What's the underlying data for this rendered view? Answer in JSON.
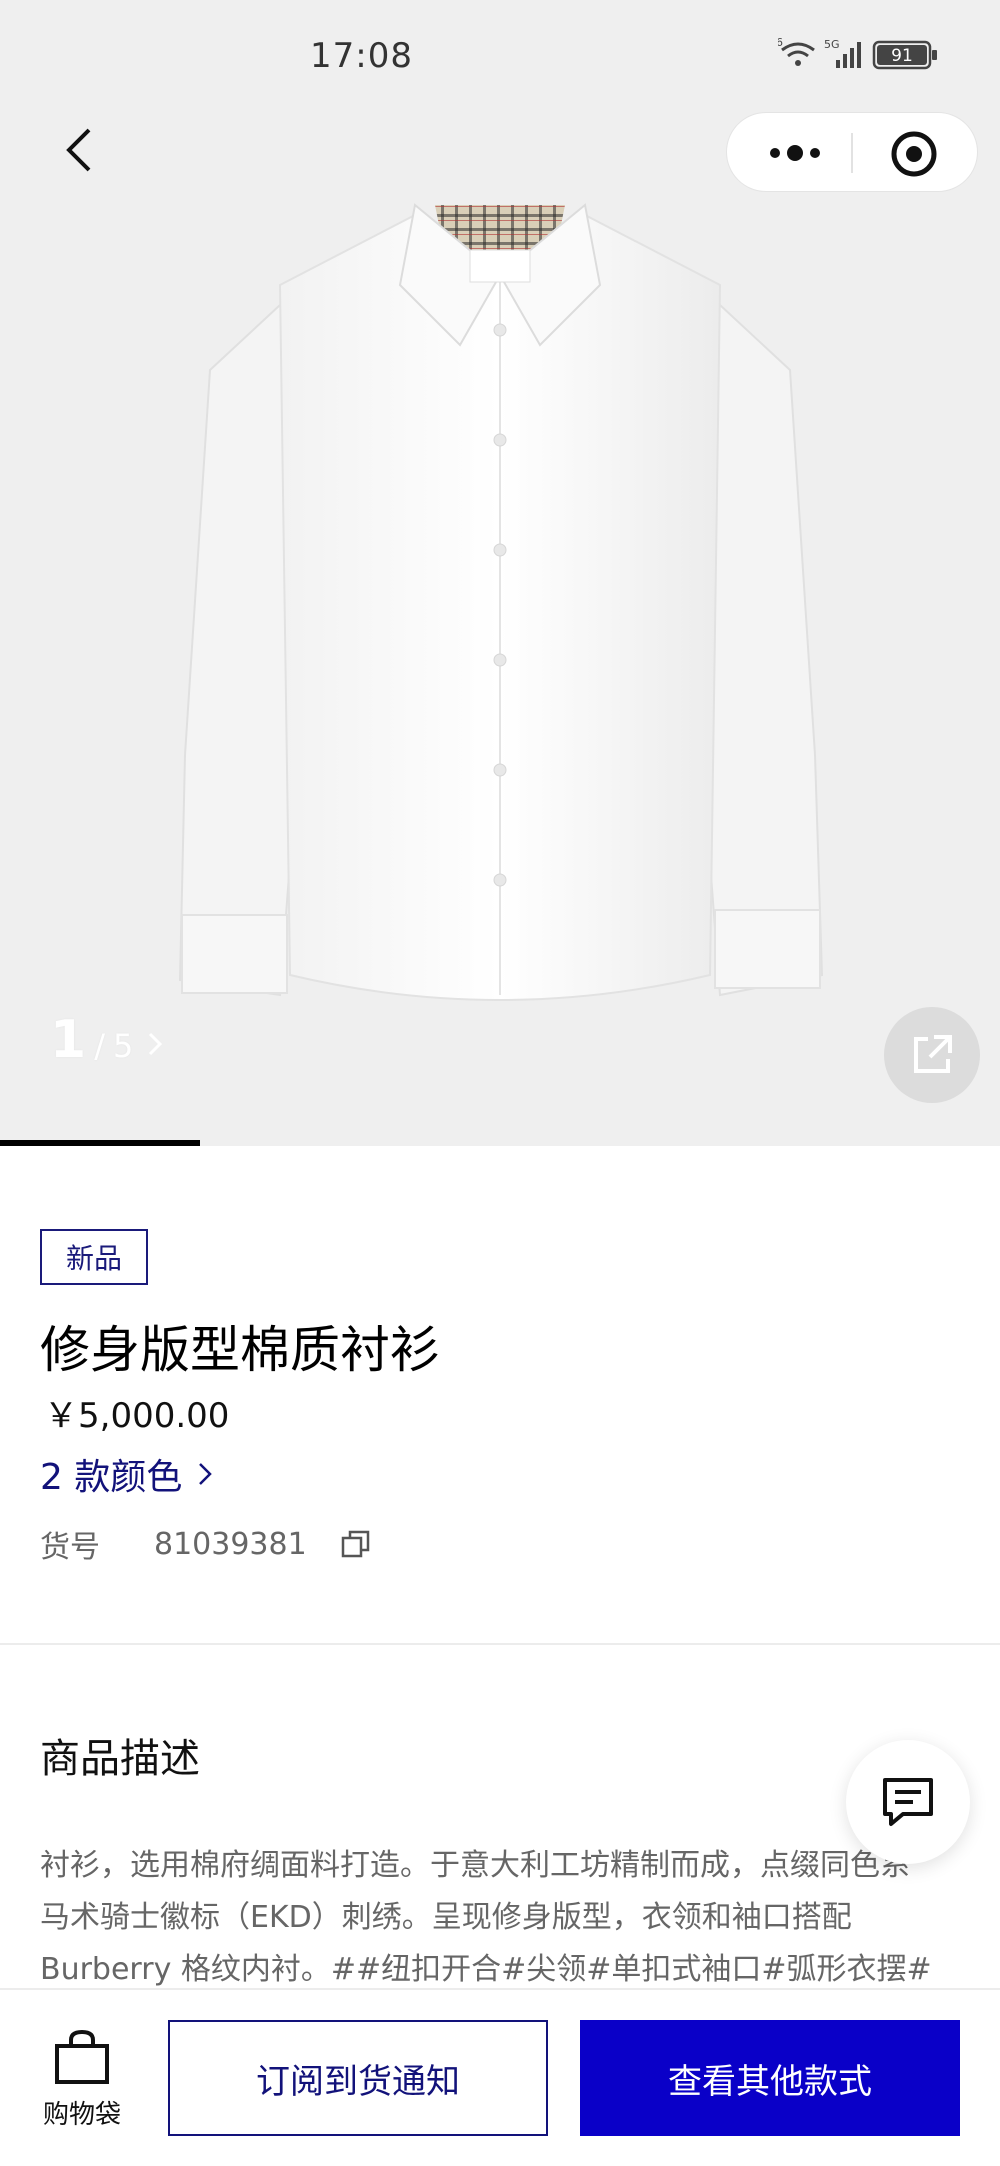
{
  "status_bar": {
    "time": "17:08",
    "network": "5G",
    "wifi_badge": "6",
    "battery": "91"
  },
  "nav": {
    "back_icon": "chevron-left-icon",
    "more_icon": "more-dots-icon",
    "target_icon": "target-icon"
  },
  "gallery": {
    "current": "1",
    "separator": "/",
    "total": "5",
    "progress": 0.2
  },
  "product": {
    "badge": "新品",
    "title": "修身版型棉质衬衫",
    "price": "￥5,000.00",
    "colors_link": "2 款颜色",
    "sku_label": "货号",
    "sku_number": "81039381"
  },
  "description": {
    "heading": "商品描述",
    "text": "衬衫，选用棉府绸面料打造。于意大利工坊精制而成，点缀同色系\n马术骑士徽标（EKD）刺绣。呈现修身版型，衣领和袖口搭配\nBurberry 格纹内衬。##纽扣开合#尖领#单扣式袖口#弧形衣摆#"
  },
  "bottom_bar": {
    "bag_label": "购物袋",
    "notify_label": "订阅到货通知",
    "other_styles_label": "查看其他款式"
  },
  "colors": {
    "accent_navy": "#12127a",
    "primary_button": "#0a00c8",
    "hero_bg": "#efefef"
  }
}
